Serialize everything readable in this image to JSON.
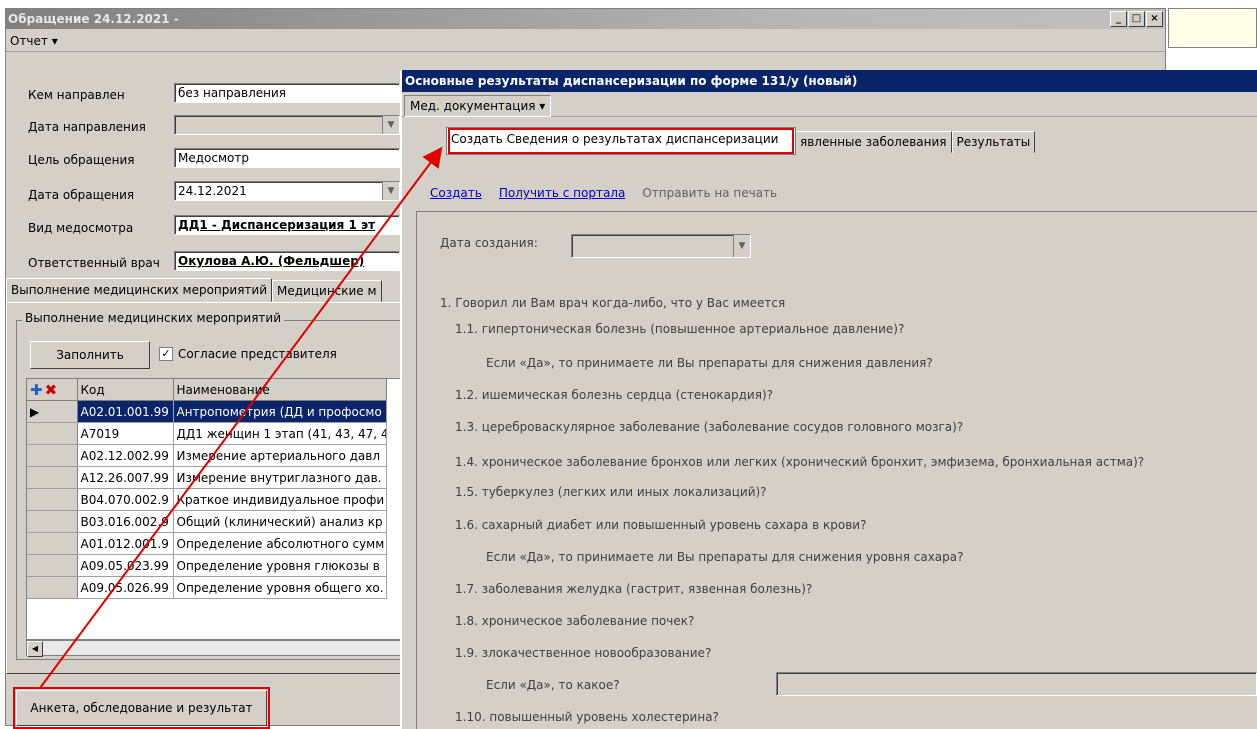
{
  "main_window": {
    "title": "Обращение 24.12.2021 -",
    "menu": {
      "report": "Отчет ▾"
    },
    "fields": [
      {
        "label": "Кем направлен",
        "value": "без направления"
      },
      {
        "label": "Дата направления",
        "value": ""
      },
      {
        "label": "Цель обращения",
        "value": "Медосмотр"
      },
      {
        "label": "Дата обращения",
        "value": "24.12.2021"
      },
      {
        "label": "Вид медосмотра",
        "value": "ДД1 - Диспансеризация 1 эт"
      },
      {
        "label": "Ответственный врач",
        "value": "Окулова А.Ю. (Фельдшер)"
      }
    ],
    "tabs": [
      "Выполнение медицинских мероприятий",
      "Медицинские м"
    ],
    "group_title": "Выполнение медицинских мероприятий",
    "fill_button": "Заполнить",
    "consent_checkbox": {
      "label": "Согласие представителя",
      "checked": true
    },
    "grid": {
      "columns": [
        "Код",
        "Наименование"
      ],
      "rows": [
        {
          "code": "A02.01.001.99",
          "name": "Антропометрия (ДД и профосмо"
        },
        {
          "code": "A7019",
          "name": "ДД1 женщин 1 этап (41, 43, 47, 4"
        },
        {
          "code": "A02.12.002.99",
          "name": "Измерение артериального давл"
        },
        {
          "code": "A12.26.007.99",
          "name": "Измерение внутриглазного дав."
        },
        {
          "code": "B04.070.002.9",
          "name": "Краткое индивидуальное профи"
        },
        {
          "code": "B03.016.002.9",
          "name": "Общий (клинический) анализ кр"
        },
        {
          "code": "A01.012.001.9",
          "name": "Определение абсолютного сумм"
        },
        {
          "code": "A09.05.023.99",
          "name": "Определение уровня глюкозы в"
        },
        {
          "code": "A09.05.026.99",
          "name": "Определение уровня общего хо."
        }
      ]
    },
    "bottom_button": "Анкета, обследование и результат"
  },
  "dialog": {
    "title": "Основные результаты диспансеризации по форме 131/у (новый)",
    "menu": "Мед. документация ▾",
    "dropdown_item": "Создать Сведения о результатах диспансеризации",
    "tabs": [
      "явленные заболевания",
      "Результаты"
    ],
    "links": {
      "create": "Создать",
      "get_portal": "Получить с портала",
      "print": "Отправить на печать"
    },
    "date_label": "Дата создания:",
    "questions": [
      "1. Говорил ли Вам врач когда-либо, что у Вас имеется",
      "1.1. гипертоническая болезнь (повышенное артериальное давление)?",
      "Если «Да», то принимаете ли Вы препараты для снижения давления?",
      "1.2. ишемическая болезнь сердца (стенокардия)?",
      "1.3. цереброваскулярное заболевание (заболевание сосудов головного мозга)?",
      "1.4. хроническое заболевание бронхов или легких (хронический бронхит, эмфизема, бронхиальная астма)?",
      "1.5. туберкулез (легких или иных локализаций)?",
      "1.6. сахарный диабет или повышенный уровень сахара в крови?",
      "Если «Да», то принимаете ли Вы препараты для снижения уровня сахара?",
      "1.7. заболевания желудка (гастрит, язвенная болезнь)?",
      "1.8. хроническое заболевание почек?",
      "1.9. злокачественное новообразование?",
      "Если «Да», то какое?",
      "1.10. повышенный уровень холестерина?"
    ]
  },
  "colors": {
    "annotation": "#e00000",
    "selection": "#0a246a",
    "link": "#0000cc"
  }
}
